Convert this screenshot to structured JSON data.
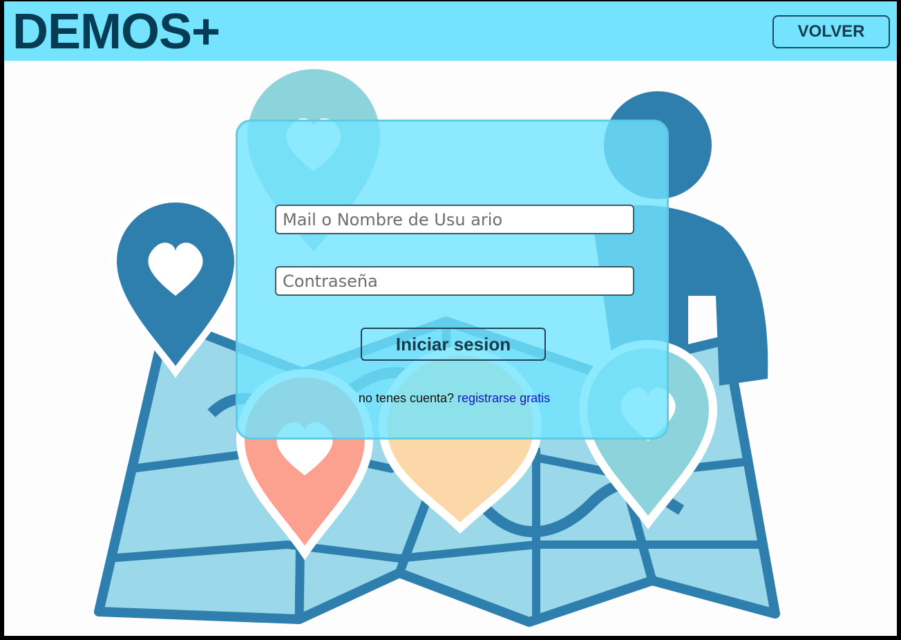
{
  "header": {
    "logo": "DEMOS+",
    "back_label": "VOLVER"
  },
  "login": {
    "user_placeholder": "Mail o Nombre de Usu ario",
    "password_placeholder": "Contraseña",
    "submit_label": "Iniciar sesion",
    "no_account_text": "no tenes cuenta?",
    "signup_link": "registrarse gratis"
  },
  "icons": [
    "map-icon",
    "heart-pin-icon",
    "person-icon"
  ],
  "colors": {
    "header_bg": "#74e4fe",
    "logo": "#073c55",
    "card_bg": "#70e4fc",
    "link": "#1414c8",
    "map_blue": "#2f7fae",
    "map_light": "#9ad8ea",
    "pin_red": "#fca08f",
    "pin_orange": "#fcd7a7",
    "pin_teal": "#8dd3dc"
  }
}
